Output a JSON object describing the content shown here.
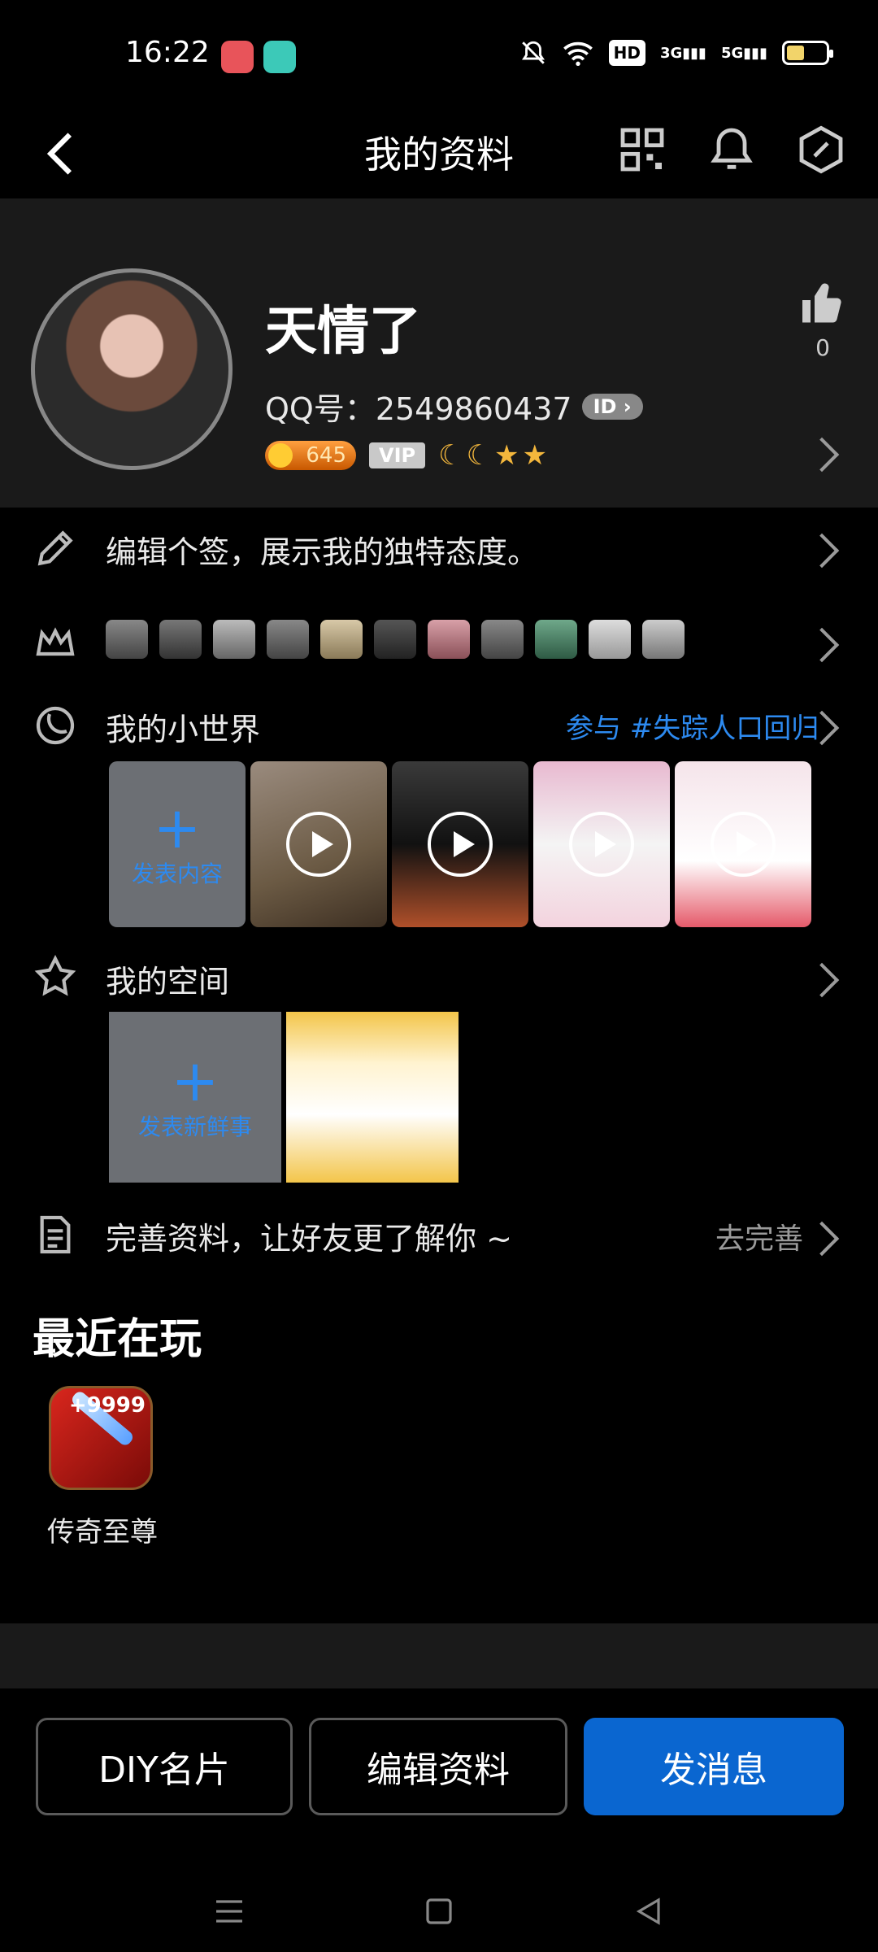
{
  "status_bar": {
    "time": "16:22",
    "hd": "HD",
    "net1": "3G",
    "net2": "5G"
  },
  "header": {
    "title": "我的资料"
  },
  "profile": {
    "nickname": "天情了",
    "qq_label": "QQ号：2549860437",
    "id_badge": "ID",
    "coins": "645",
    "vip": "VIP",
    "level_icons": "☾☾★★",
    "likes": "0"
  },
  "rows": {
    "signature": "编辑个签，展示我的独特态度。",
    "small_world": "我的小世界",
    "small_world_topic": "参与 #失踪人口回归",
    "post_content": "发表内容",
    "space": "我的空间",
    "post_news": "发表新鲜事",
    "complete_profile": "完善资料，让好友更了解你 ~",
    "complete_action": "去完善"
  },
  "recent": {
    "title": "最近在玩",
    "game_name": "传奇至尊",
    "game_badge": "+9999"
  },
  "buttons": {
    "diy": "DIY名片",
    "edit": "编辑资料",
    "message": "发消息"
  },
  "colors": {
    "accent": "#0a66d0",
    "link": "#2d8af0",
    "background": "#000000",
    "card": "#1a1a1a"
  }
}
